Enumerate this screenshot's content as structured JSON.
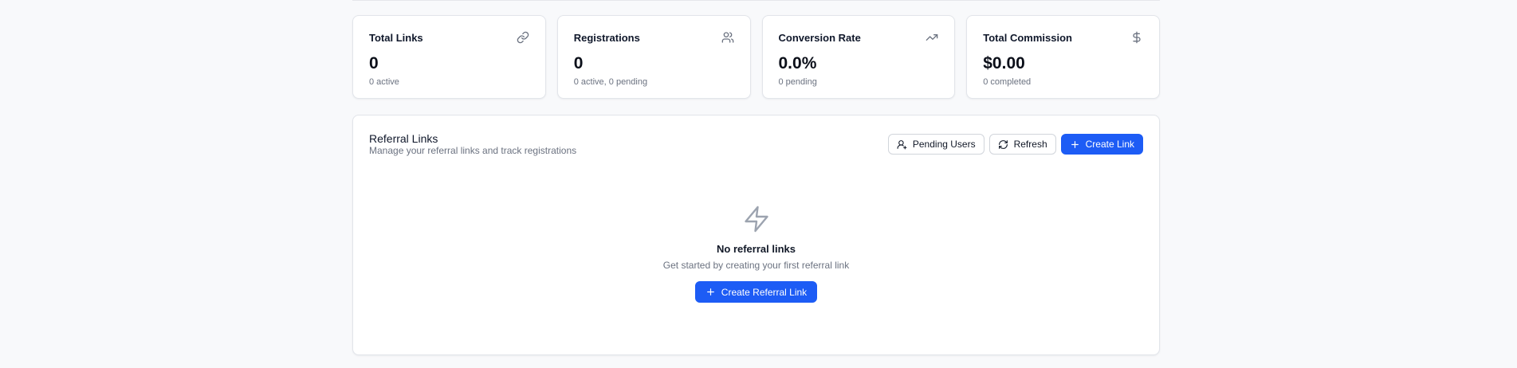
{
  "stats": [
    {
      "title": "Total Links",
      "value": "0",
      "sub": "0 active",
      "icon": "link-icon"
    },
    {
      "title": "Registrations",
      "value": "0",
      "sub": "0 active, 0 pending",
      "icon": "users-icon"
    },
    {
      "title": "Conversion Rate",
      "value": "0.0%",
      "sub": "0 pending",
      "icon": "trending-up-icon"
    },
    {
      "title": "Total Commission",
      "value": "$0.00",
      "sub": "0 completed",
      "icon": "dollar-icon"
    }
  ],
  "panel": {
    "title": "Referral Links",
    "description": "Manage your referral links and track registrations",
    "actions": {
      "pending_users": "Pending Users",
      "refresh": "Refresh",
      "create_link": "Create Link"
    },
    "empty": {
      "icon": "lightning-icon",
      "title": "No referral links",
      "description": "Get started by creating your first referral link",
      "button": "Create Referral Link"
    }
  },
  "colors": {
    "primary": "#1d5cf5",
    "background": "#f8f9fb",
    "muted_text": "#6b7280",
    "border": "#e2e5ea"
  }
}
